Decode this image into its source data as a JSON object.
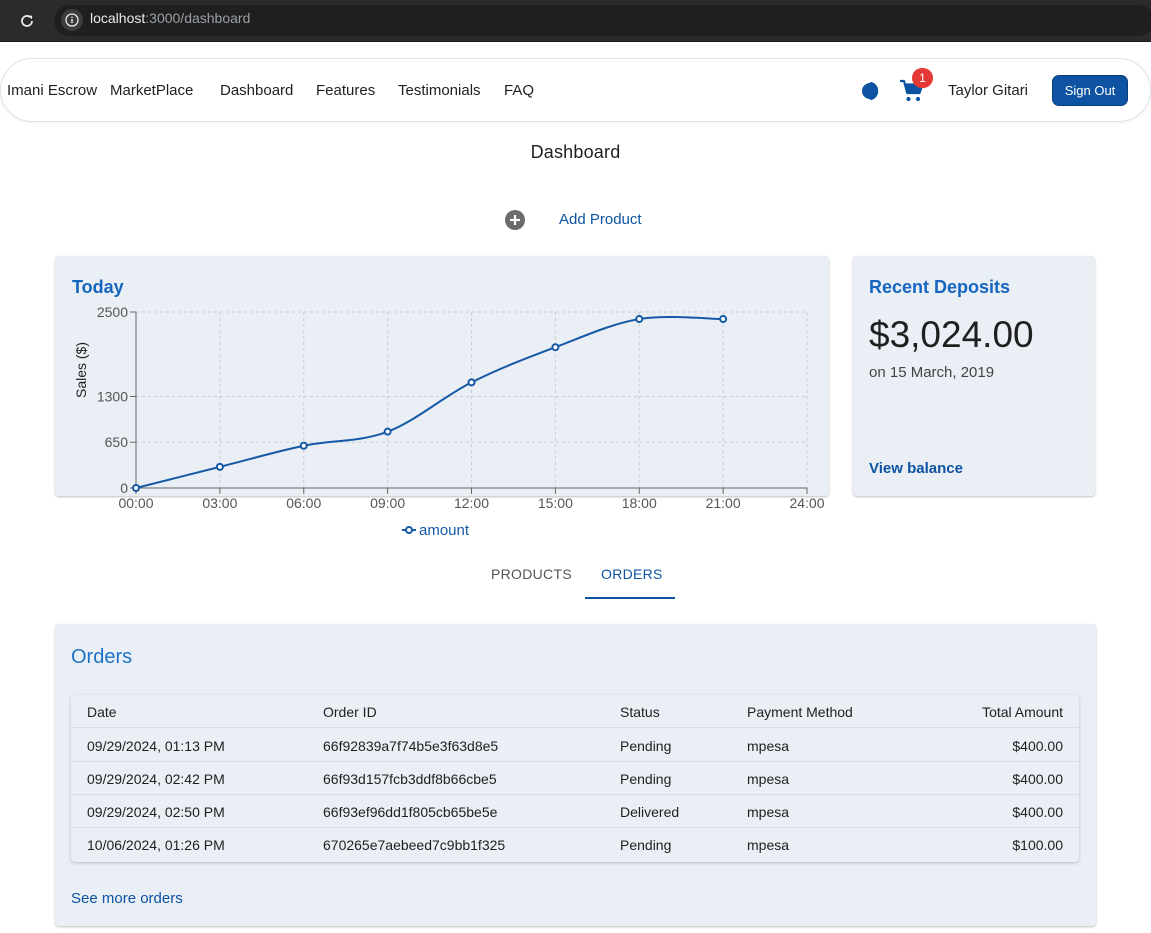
{
  "browser": {
    "url_host": "localhost",
    "url_path": ":3000/dashboard"
  },
  "nav": {
    "links": [
      "Imani Escrow",
      "MarketPlace",
      "Dashboard",
      "Features",
      "Testimonials",
      "FAQ"
    ],
    "cart_count": "1",
    "user_name": "Taylor Gitari",
    "sign_out": "Sign Out"
  },
  "page": {
    "title": "Dashboard",
    "add_product": "Add Product"
  },
  "today": {
    "title": "Today"
  },
  "deposits": {
    "title": "Recent Deposits",
    "amount": "$3,024.00",
    "date": "on 15 March, 2019",
    "link": "View balance"
  },
  "tabs": [
    "PRODUCTS",
    "ORDERS"
  ],
  "active_tab": "ORDERS",
  "orders": {
    "title": "Orders",
    "columns": [
      "Date",
      "Order ID",
      "Status",
      "Payment Method",
      "Total Amount"
    ],
    "rows": [
      [
        "09/29/2024, 01:13 PM",
        "66f92839a7f74b5e3f63d8e5",
        "Pending",
        "mpesa",
        "$400.00"
      ],
      [
        "09/29/2024, 02:42 PM",
        "66f93d157fcb3ddf8b66cbe5",
        "Pending",
        "mpesa",
        "$400.00"
      ],
      [
        "09/29/2024, 02:50 PM",
        "66f93ef96dd1f805cb65be5e",
        "Delivered",
        "mpesa",
        "$400.00"
      ],
      [
        "10/06/2024, 01:26 PM",
        "670265e7aebeed7c9bb1f325",
        "Pending",
        "mpesa",
        "$100.00"
      ]
    ],
    "see_more": "See more orders"
  },
  "colors": {
    "accent": "#0d53a2",
    "heading": "#1565c0",
    "card_bg": "#eaeef5",
    "badge": "#e53935"
  },
  "chart_data": {
    "type": "line",
    "title": "",
    "xlabel": "",
    "ylabel": "Sales ($)",
    "x": [
      "00:00",
      "03:00",
      "06:00",
      "09:00",
      "12:00",
      "15:00",
      "18:00",
      "21:00"
    ],
    "x_ticks": [
      "00:00",
      "03:00",
      "06:00",
      "09:00",
      "12:00",
      "15:00",
      "18:00",
      "21:00",
      "24:00"
    ],
    "y_ticks": [
      0,
      650,
      1300,
      2500
    ],
    "ylim": [
      0,
      2500
    ],
    "series": [
      {
        "name": "amount",
        "values": [
          0,
          300,
          600,
          800,
          1500,
          2000,
          2400,
          2400
        ]
      }
    ],
    "grid": true,
    "legend_position": "bottom"
  }
}
